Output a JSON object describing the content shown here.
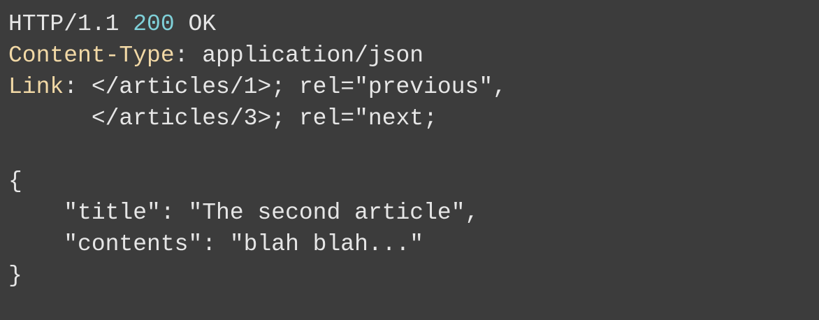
{
  "colors": {
    "background": "#3c3c3c",
    "text": "#e6e6e6",
    "header_name": "#f2d9a6",
    "status_code": "#7fd0d8"
  },
  "response": {
    "status_line": {
      "protocol": "HTTP/1.1",
      "code": "200",
      "reason": "OK"
    },
    "headers": [
      {
        "name": "Content-Type",
        "sep": ": ",
        "value": "application/json"
      },
      {
        "name": "Link",
        "sep": ": ",
        "value": "</articles/1>; rel=\"previous\","
      }
    ],
    "header_continuation": "</articles/3>; rel=\"next;",
    "body_lines": [
      "{",
      "\"title\": \"The second article\",",
      "\"contents\": \"blah blah...\"",
      "}"
    ]
  }
}
